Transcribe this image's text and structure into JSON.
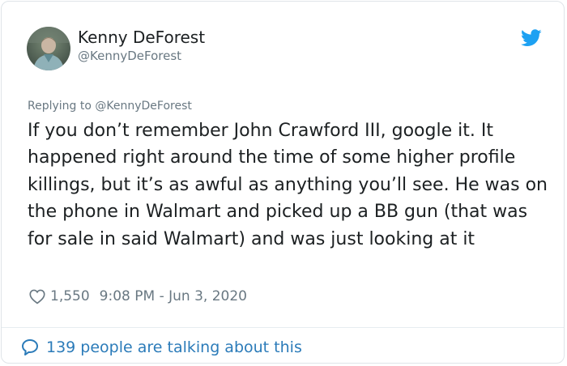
{
  "tweet": {
    "author": {
      "display_name": "Kenny DeForest",
      "handle": "@KennyDeForest",
      "avatar_icon": "user-avatar-photo"
    },
    "reply_context": "Replying to @KennyDeForest",
    "text": "If you don’t remember John Crawford III, google it. It happened right around the time of some higher profile killings, but it’s as awful as anything you’ll see. He was on the phone in Walmart and picked up a BB gun (that was for sale in said Walmart) and was just looking at it",
    "likes": "1,550",
    "timestamp": "9:08 PM - Jun 3, 2020",
    "conversation_label": "139 people are talking about this"
  },
  "icons": {
    "brand": "twitter-bird-icon",
    "like": "heart-icon",
    "conversation": "speech-bubble-icon"
  },
  "colors": {
    "twitter_blue": "#1da1f2",
    "link_blue": "#2b7bb9",
    "secondary_text": "#697882",
    "primary_text": "#1c2022"
  }
}
